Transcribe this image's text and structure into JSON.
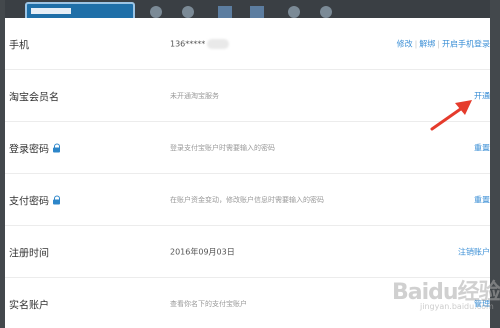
{
  "rows": [
    {
      "label": "手机",
      "value": "136*****",
      "actions": [
        "修改",
        "解绑",
        "开启手机登录"
      ]
    },
    {
      "label": "淘宝会员名",
      "value": "未开通淘宝服务",
      "actions": [
        "开通"
      ]
    },
    {
      "label": "登录密码",
      "value": "登录支付宝账户时需要输入的密码",
      "actions": [
        "重置"
      ]
    },
    {
      "label": "支付密码",
      "value": "在账户资金变动，修改账户信息时需要输入的密码",
      "actions": [
        "重置"
      ]
    },
    {
      "label": "注册时间",
      "value": "2016年09月03日",
      "actions": [
        "注销账户"
      ]
    },
    {
      "label": "实名账户",
      "value": "查看你名下的支付宝账户",
      "actions": [
        "管理"
      ]
    }
  ],
  "watermark": {
    "logo": "Baidu经验",
    "sub": "jingyan.baidu.com"
  },
  "colors": {
    "link": "#3b8fd6",
    "arrow": "#e53b2c",
    "lock": "#2d86c9"
  }
}
